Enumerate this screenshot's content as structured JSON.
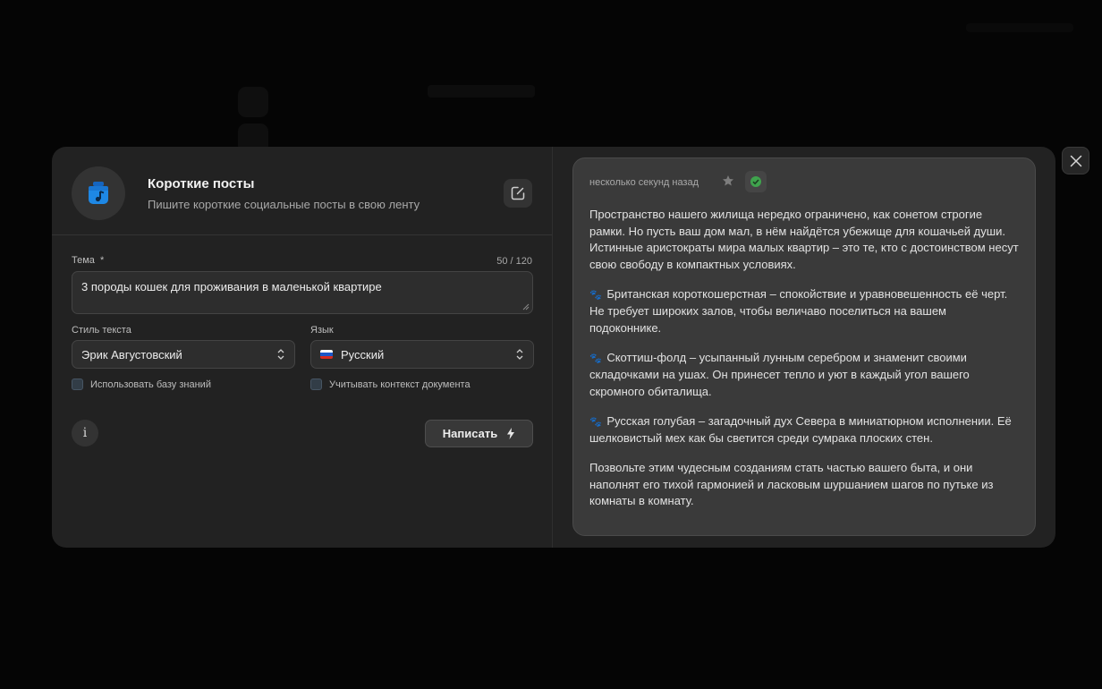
{
  "header": {
    "title": "Короткие посты",
    "subtitle": "Пишите короткие социальные посты в свою ленту"
  },
  "form": {
    "topic_label": "Тема",
    "required_mark": "*",
    "counter": "50 / 120",
    "topic_value": "3 породы кошек для проживания в маленькой квартире",
    "style_label": "Стиль текста",
    "style_value": "Эрик Августовский",
    "language_label": "Язык",
    "language_value": "Русский",
    "use_knowledge_base": "Использовать базу знаний",
    "use_document_context": "Учитывать контекст документа",
    "info_glyph": "i",
    "write_button": "Написать"
  },
  "result": {
    "timestamp": "несколько секунд назад",
    "paragraphs": [
      "Пространство нашего жилища нередко ограничено, как сонетом строгие рамки. Но пусть ваш дом мал, в нём найдётся убежище для кошачьей души. Истинные аристократы мира малых квартир – это те, кто с достоинством несут свою свободу в компактных условиях.",
      "Британская короткошерстная – спокойствие и уравновешенность её черт. Не требует широких залов, чтобы величаво поселиться на вашем подоконнике.",
      "Скоттиш-фолд – усыпанный лунным серебром и знаменит своими складочками на ушах. Он принесет тепло и уют в каждый угол вашего скромного обиталища.",
      "Русская голубая – загадочный дух Севера в миниатюрном исполнении. Её шелковистый мех как бы светится среди сумрака плоских стен.",
      "Позвольте этим чудесным созданиям стать частью вашего быта, и они наполнят его тихой гармонией и ласковым шуршанием шагов по путьке из комнаты в комнату."
    ]
  },
  "icons": {
    "app": "music-bag-icon",
    "edit": "edit-icon",
    "star": "star-icon",
    "check": "check-circle-icon",
    "close": "close-icon",
    "bolt": "lightning-icon",
    "paw": "paw-icon"
  },
  "colors": {
    "app_icon_blue": "#1e88e5",
    "check_green": "#3fa34d",
    "modal_bg": "#222222",
    "result_bg": "#3a3a3a"
  }
}
